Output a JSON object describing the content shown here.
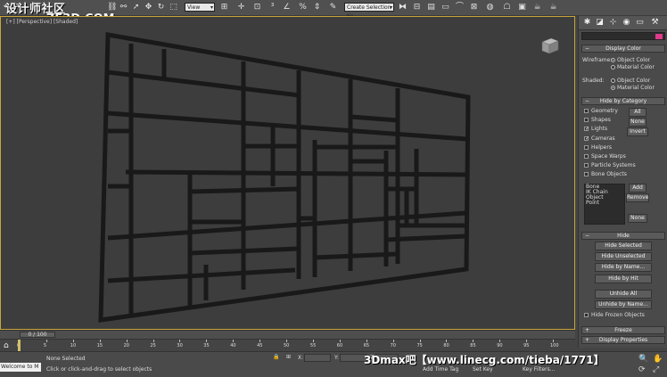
{
  "watermark": {
    "line1": "设计师社区",
    "line2": "ZF3D.COM"
  },
  "toolbar": {
    "view_dropdown": "View",
    "selection_set_dropdown": "Create Selection Se"
  },
  "viewport": {
    "label": "[+] [Perspective] [Shaded]"
  },
  "command_panel": {
    "display_color": {
      "title": "Display Color",
      "wireframe_label": "Wireframe:",
      "shaded_label": "Shaded:",
      "object_color": "Object Color",
      "material_color": "Material Color",
      "wireframe_selected": "object",
      "shaded_selected": "material"
    },
    "hide_by_category": {
      "title": "Hide by Category",
      "items": [
        {
          "label": "Geometry",
          "checked": false
        },
        {
          "label": "Shapes",
          "checked": false
        },
        {
          "label": "Lights",
          "checked": true
        },
        {
          "label": "Cameras",
          "checked": true
        },
        {
          "label": "Helpers",
          "checked": false
        },
        {
          "label": "Space Warps",
          "checked": false
        },
        {
          "label": "Particle Systems",
          "checked": false
        },
        {
          "label": "Bone Objects",
          "checked": false
        }
      ],
      "all_button": "All",
      "none_button": "None",
      "invert_button": "Invert",
      "list_items": [
        "Bone",
        "IK Chain Object",
        "Point"
      ],
      "add_button": "Add",
      "remove_button": "Remove",
      "list_none_button": "None"
    },
    "hide": {
      "title": "Hide",
      "buttons": [
        "Hide Selected",
        "Hide Unselected",
        "Hide by Name...",
        "Hide by Hit",
        "Unhide All",
        "Unhide by Name..."
      ],
      "hide_frozen_label": "Hide Frozen Objects"
    },
    "freeze": {
      "title": "Freeze"
    },
    "display_properties": {
      "title": "Display Properties"
    }
  },
  "timeline": {
    "frame_counter": "0 / 100",
    "ticks": [
      "0",
      "5",
      "10",
      "15",
      "20",
      "25",
      "30",
      "35",
      "40",
      "45",
      "50",
      "55",
      "60",
      "65",
      "70",
      "75",
      "80",
      "85",
      "90",
      "95",
      "100"
    ]
  },
  "status": {
    "welcome": "Welcome to M",
    "selection": "None Selected",
    "prompt": "Click or click-and-drag to select objects",
    "x_label": "X:",
    "y_label": "Y:",
    "z_label": "Z:",
    "set_key": "Set Key",
    "key_filters": "Key Filters...",
    "add_time_tag": "Add Time Tag"
  },
  "banner": "3Dmax吧【www.linecg.com/tieba/1771】"
}
